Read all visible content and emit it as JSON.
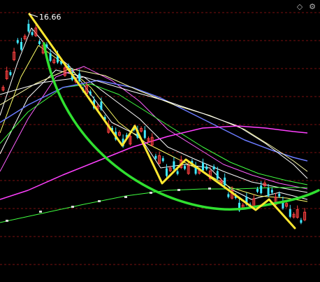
{
  "chart_data": {
    "type": "candlestick",
    "annotations": {
      "peak_label": "16.66"
    },
    "colors": {
      "background": "#000000",
      "up_candle": "#ff4040",
      "down_candle": "#40e8ff",
      "trend_line": "#ffe830",
      "arc": "#30e030",
      "grid": "#7a1010"
    },
    "icons": [
      "diamond-icon",
      "settings-icon"
    ],
    "grid": true,
    "legend": "none"
  }
}
